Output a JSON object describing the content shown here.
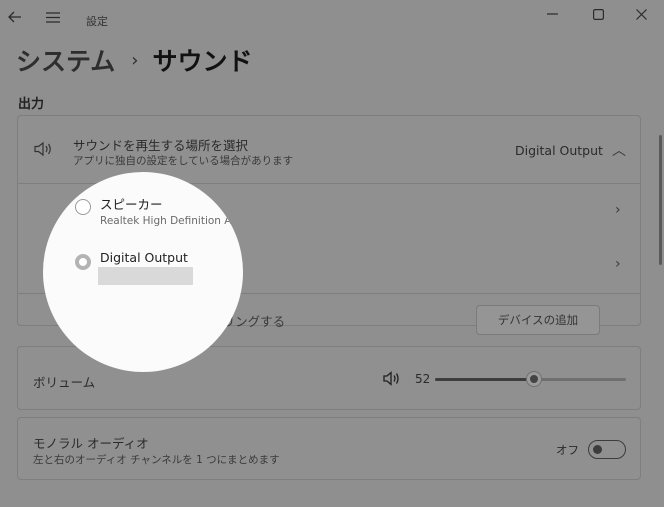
{
  "titlebar": {
    "title": "設定"
  },
  "window_controls": {
    "minimize": "─",
    "maximize": "☐",
    "close": "✕"
  },
  "breadcrumb": {
    "parent": "システム",
    "separator": "›",
    "current": "サウンド"
  },
  "output_section": {
    "title": "出力",
    "select": {
      "label": "サウンドを再生する場所を選択",
      "sub": "アプリに独自の設定をしている場合があります",
      "value": "Digital Output",
      "chevron": "︿"
    },
    "devices": [
      {
        "name": "スピーカー",
        "sub": "Realtek High Definition Audio",
        "chevron": "›",
        "selected": false
      },
      {
        "name": "Digital Output",
        "sub": "",
        "chevron": "›",
        "selected": true
      }
    ],
    "pair": {
      "label": "新しい出力デバイスをペアリングする",
      "button": "デバイスの追加"
    }
  },
  "volume": {
    "label": "ボリューム",
    "value": 52,
    "value_text": "52"
  },
  "mono": {
    "label": "モノラル オーディオ",
    "sub": "左と右のオーディオ チャンネルを 1 つにまとめます",
    "state": "オフ",
    "on": false
  },
  "colors": {
    "dim_bg": "#8f8f8f",
    "spotlight": "#fbfbfb"
  }
}
